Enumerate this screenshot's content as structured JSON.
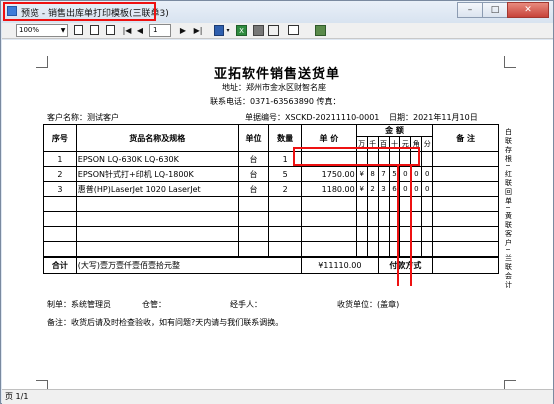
{
  "window": {
    "title": "预览 - 销售出库单打印模板(三联单3)",
    "buttons": {
      "minimize": "–",
      "maximize": "□",
      "close": "✕"
    }
  },
  "toolbar": {
    "zoom": "100%",
    "page_input": "1",
    "icons": [
      "page-width-icon",
      "two-page-icon",
      "whole-page-icon",
      "first-page-icon",
      "prev-page-icon",
      "next-page-icon",
      "last-page-icon",
      "save-icon",
      "excel-icon",
      "print-icon",
      "print-setup-icon",
      "exit-icon"
    ]
  },
  "document": {
    "title": "亚拓软件销售送货单",
    "address": "地址：郑州市金水区财智名座",
    "phone": "联系电话：0371-63563890  传真：",
    "customer": "客户名称：测试客户",
    "doc_no": "单据编号：XSCKD-20211110-0001",
    "date": "日期：2021年11月10日",
    "headers": {
      "seq": "序号",
      "name": "货品名称及规格",
      "unit": "单位",
      "qty": "数量",
      "price": "单 价",
      "amount": "金 额",
      "remark": "备 注",
      "digits": [
        "万",
        "千",
        "百",
        "十",
        "元",
        "角",
        "分"
      ]
    },
    "rows": [
      {
        "seq": "1",
        "name": "EPSON LQ-630K LQ-630K",
        "unit": "台",
        "qty": "1",
        "price": "",
        "digits": [
          "",
          "",
          "",
          "",
          "",
          "",
          ""
        ]
      },
      {
        "seq": "2",
        "name": "EPSON针式打+印机 LQ-1800K",
        "unit": "台",
        "qty": "5",
        "price": "1750.00",
        "digits": [
          "¥",
          "8",
          "7",
          "5",
          "0",
          "0",
          "0"
        ]
      },
      {
        "seq": "3",
        "name": "惠普(HP)LaserJet 1020 LaserJet",
        "unit": "台",
        "qty": "2",
        "price": "1180.00",
        "digits": [
          "¥",
          "2",
          "3",
          "6",
          "0",
          "0",
          "0"
        ]
      }
    ],
    "total_label": "合计",
    "total_words": "(大写)壹万壹仟壹佰壹拾元整",
    "total_amount": "¥11110.00",
    "payment_label": "付款方式",
    "footer": {
      "maker": "制单：系统管理员",
      "warehouse": "仓管：",
      "handler": "经手人：",
      "receiver": "收货单位：(盖章)"
    },
    "note": "备注：收货后请及时检查验收，如有问题?天内请与我们联系调换。",
    "side_labels": [
      "白联存根",
      "红联回单",
      "黄联客户",
      "兰联会计"
    ]
  },
  "status": {
    "page": "页 1/1"
  }
}
